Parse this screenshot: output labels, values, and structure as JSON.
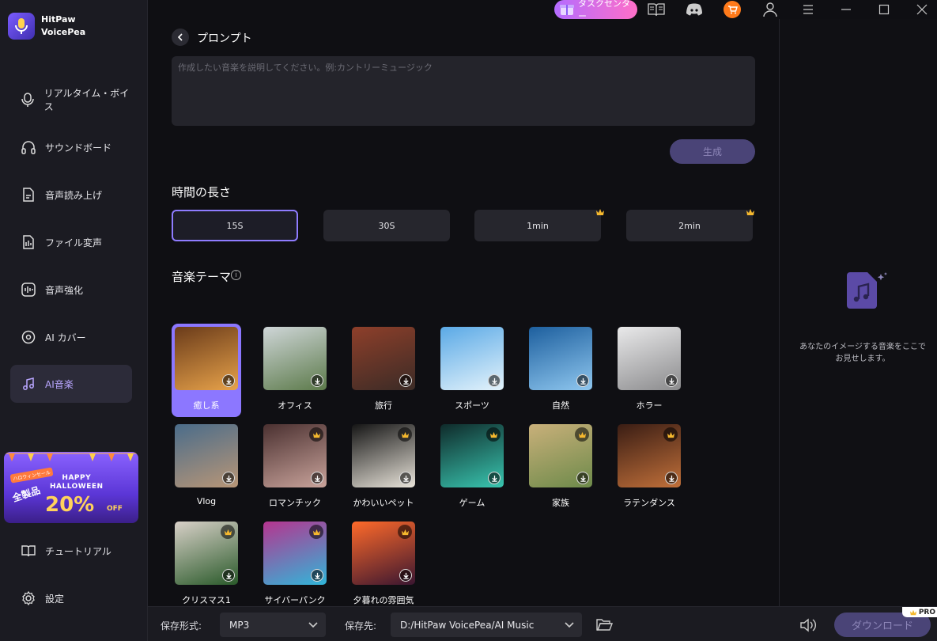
{
  "app": {
    "name_line1": "HitPaw",
    "name_line2": "VoicePea"
  },
  "topbar": {
    "task_center": "タスクセンター"
  },
  "sidebar": {
    "items": [
      {
        "label": "リアルタイム・ボイス",
        "icon": "microphone-icon"
      },
      {
        "label": "サウンドボード",
        "icon": "headphones-icon"
      },
      {
        "label": "音声読み上げ",
        "icon": "tts-document-icon"
      },
      {
        "label": "ファイル変声",
        "icon": "audio-file-icon"
      },
      {
        "label": "音声強化",
        "icon": "enhance-wave-icon"
      },
      {
        "label": "AI カバー",
        "icon": "ai-cover-disc-icon"
      },
      {
        "label": "AI音楽",
        "icon": "ai-music-note-icon",
        "active": true
      }
    ],
    "promo": {
      "ribbon": "ハロウィンセール",
      "tag": "全製品",
      "title_line1": "HAPPY",
      "title_line2": "HALLOWEEN",
      "discount": "20%",
      "off": "OFF"
    },
    "tutorial": "チュートリアル",
    "settings": "設定"
  },
  "prompt": {
    "title": "プロンプト",
    "placeholder": "作成したい音楽を説明してください。例:カントリーミュージック",
    "generate": "生成"
  },
  "duration": {
    "title": "時間の長さ",
    "options": [
      {
        "label": "15S",
        "selected": true,
        "premium": false
      },
      {
        "label": "30S",
        "selected": false,
        "premium": false
      },
      {
        "label": "1min",
        "selected": false,
        "premium": true
      },
      {
        "label": "2min",
        "selected": false,
        "premium": true
      }
    ]
  },
  "theme": {
    "title": "音楽テーマ",
    "items": [
      {
        "label": "癒し系",
        "selected": true,
        "premium": false
      },
      {
        "label": "オフィス",
        "selected": false,
        "premium": false
      },
      {
        "label": "旅行",
        "selected": false,
        "premium": false
      },
      {
        "label": "スポーツ",
        "selected": false,
        "premium": false
      },
      {
        "label": "自然",
        "selected": false,
        "premium": false
      },
      {
        "label": "ホラー",
        "selected": false,
        "premium": false
      },
      {
        "label": "Vlog",
        "selected": false,
        "premium": false
      },
      {
        "label": "ロマンチック",
        "selected": false,
        "premium": true
      },
      {
        "label": "かわいいペット",
        "selected": false,
        "premium": true
      },
      {
        "label": "ゲーム",
        "selected": false,
        "premium": true
      },
      {
        "label": "家族",
        "selected": false,
        "premium": true
      },
      {
        "label": "ラテンダンス",
        "selected": false,
        "premium": true
      },
      {
        "label": "クリスマス1",
        "selected": false,
        "premium": true
      },
      {
        "label": "サイバーパンク",
        "selected": false,
        "premium": true
      },
      {
        "label": "夕暮れの雰囲気",
        "selected": false,
        "premium": true
      }
    ]
  },
  "right_panel": {
    "empty_text_line1": "あなたのイメージする音楽をここで",
    "empty_text_line2": "お見せします。"
  },
  "bottom": {
    "format_label": "保存形式:",
    "format_value": "MP3",
    "dest_label": "保存先:",
    "dest_value": "D:/HitPaw VoicePea/AI Music",
    "download": "ダウンロード",
    "pro_badge": "PRO"
  },
  "colors": {
    "accent": "#8c77ff",
    "button_disabled": "#4a4477",
    "task_gradient_start": "#b46cff",
    "task_gradient_end": "#ff6fc8",
    "crown": "#f5b82e"
  }
}
